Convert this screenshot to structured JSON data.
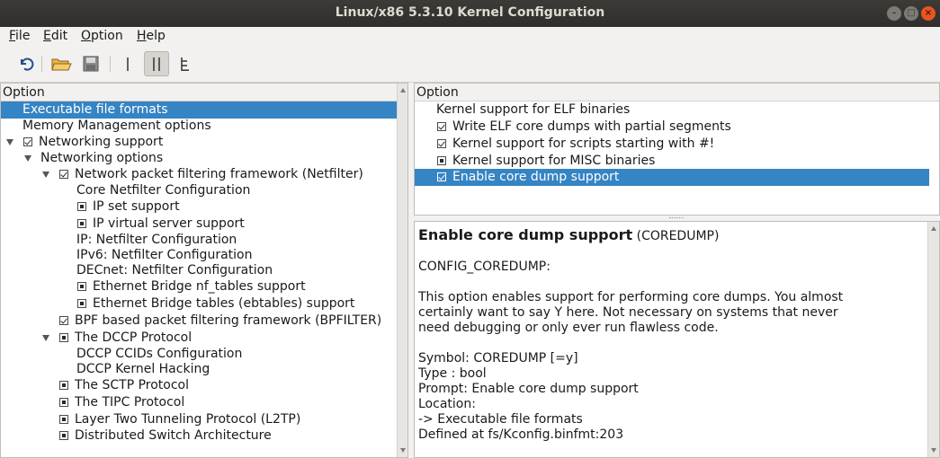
{
  "window": {
    "title": "Linux/x86 5.3.10 Kernel Configuration",
    "controls": {
      "minimize": "–",
      "maximize": "□",
      "close": "×"
    }
  },
  "menubar": {
    "items": [
      {
        "label_ul": "F",
        "label_rest": "ile"
      },
      {
        "label_ul": "E",
        "label_rest": "dit"
      },
      {
        "label_ul": "O",
        "label_rest": "ption"
      },
      {
        "label_ul": "H",
        "label_rest": "elp"
      }
    ]
  },
  "toolbar": {
    "icons": [
      "undo-icon",
      "open-folder-icon",
      "save-icon",
      "single-view-icon",
      "split-view-icon",
      "full-view-icon"
    ],
    "pressed": "split-view-icon"
  },
  "left_panel": {
    "header": "Option",
    "rows": [
      {
        "label": "Executable file formats",
        "selected": true
      },
      {
        "label": "Memory Management options"
      },
      {
        "label": "Networking support"
      },
      {
        "label": "Networking options"
      },
      {
        "label": "Network packet filtering framework (Netfilter)"
      },
      {
        "label": "Core Netfilter Configuration"
      },
      {
        "label": "IP set support"
      },
      {
        "label": "IP virtual server support"
      },
      {
        "label": "IP: Netfilter Configuration"
      },
      {
        "label": "IPv6: Netfilter Configuration"
      },
      {
        "label": "DECnet: Netfilter Configuration"
      },
      {
        "label": "Ethernet Bridge nf_tables support"
      },
      {
        "label": "Ethernet Bridge tables (ebtables) support"
      },
      {
        "label": "BPF based packet filtering framework (BPFILTER)"
      },
      {
        "label": "The DCCP Protocol"
      },
      {
        "label": "DCCP CCIDs Configuration"
      },
      {
        "label": "DCCP Kernel Hacking"
      },
      {
        "label": "The SCTP Protocol"
      },
      {
        "label": "The TIPC Protocol"
      },
      {
        "label": "Layer Two Tunneling Protocol (L2TP)"
      },
      {
        "label": "Distributed Switch Architecture"
      }
    ]
  },
  "right_panel": {
    "header": "Option",
    "rows": [
      {
        "label": "Kernel support for ELF binaries"
      },
      {
        "label": "Write ELF core dumps with partial segments"
      },
      {
        "label": "Kernel support for scripts starting with #!"
      },
      {
        "label": "Kernel support for MISC binaries"
      },
      {
        "label": "Enable core dump support",
        "selected": true
      }
    ]
  },
  "help": {
    "title": "Enable core dump support",
    "title_suffix": " (COREDUMP)",
    "config_name": "CONFIG_COREDUMP:",
    "description_lines": [
      "This option enables support for performing core dumps. You almost",
      "certainly want to say Y here. Not necessary on systems that never",
      "need debugging or only ever run flawless code."
    ],
    "symbol": "Symbol: COREDUMP [=y]",
    "type": "Type : bool",
    "prompt": "Prompt: Enable core dump support",
    "location": "Location:",
    "location_path": "-> Executable file formats",
    "defined": "Defined at fs/Kconfig.binfmt:203"
  }
}
